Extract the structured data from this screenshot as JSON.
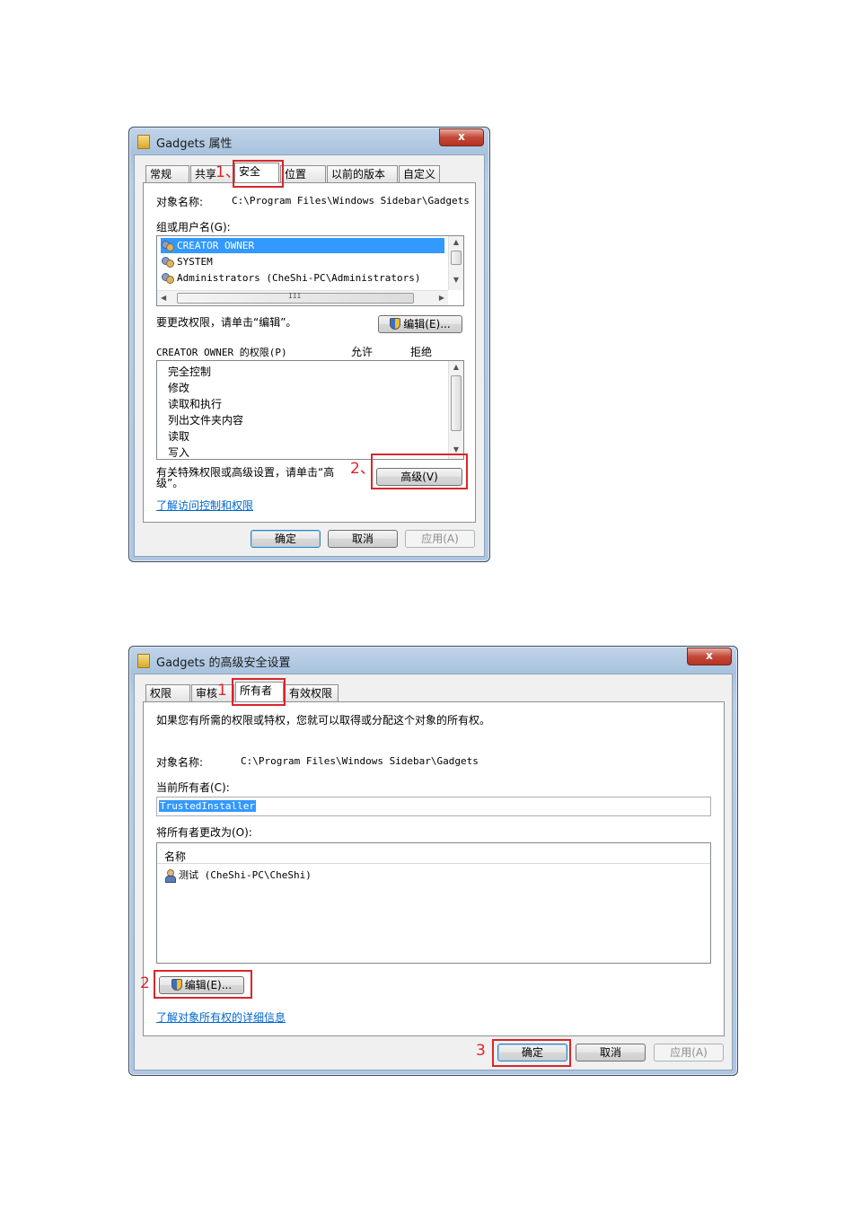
{
  "dialog1": {
    "title": "Gadgets 属性",
    "close_label": "x",
    "tabs": [
      "常规",
      "共享",
      "安全",
      "位置",
      "以前的版本",
      "自定义"
    ],
    "object_name_label": "对象名称:",
    "object_path": "C:\\Program Files\\Windows Sidebar\\Gadgets",
    "group_label": "组或用户名(G):",
    "users": [
      "CREATOR OWNER",
      "SYSTEM",
      "Administrators (CheShi-PC\\Administrators)"
    ],
    "scroll_mid": "III",
    "edit_hint": "要更改权限，请单击“编辑”。",
    "edit_button": "编辑(E)...",
    "perm_header": "CREATOR OWNER 的权限(P)",
    "allow_label": "允许",
    "deny_label": "拒绝",
    "permissions": [
      "完全控制",
      "修改",
      "读取和执行",
      "列出文件夹内容",
      "读取",
      "写入"
    ],
    "advanced_hint_1": "有关特殊权限或高级设置，请单击“高",
    "advanced_hint_2": "级”。",
    "advanced_button": "高级(V)",
    "learn_link": "了解访问控制和权限",
    "ok_button": "确定",
    "cancel_button": "取消",
    "apply_button": "应用(A)",
    "annot_1": "1、",
    "annot_2": "2、"
  },
  "dialog2": {
    "title": "Gadgets 的高级安全设置",
    "close_label": "x",
    "tabs": [
      "权限",
      "审核",
      "所有者",
      "有效权限"
    ],
    "intro": "如果您有所需的权限或特权，您就可以取得或分配这个对象的所有权。",
    "object_name_label": "对象名称:",
    "object_path": "C:\\Program Files\\Windows Sidebar\\Gadgets",
    "current_owner_label": "当前所有者(C):",
    "current_owner": "TrustedInstaller",
    "change_owner_label": "将所有者更改为(O):",
    "name_header": "名称",
    "candidates": [
      "测试 (CheShi-PC\\CheShi)"
    ],
    "edit_button": "编辑(E)...",
    "learn_link": "了解对象所有权的详细信息",
    "ok_button": "确定",
    "cancel_button": "取消",
    "apply_button": "应用(A)",
    "annot_1": "1",
    "annot_2": "2",
    "annot_3": "3"
  },
  "colors": {
    "annotation_red": "#d9262b",
    "selection_blue": "#3399ff",
    "link_blue": "#0066cc"
  }
}
